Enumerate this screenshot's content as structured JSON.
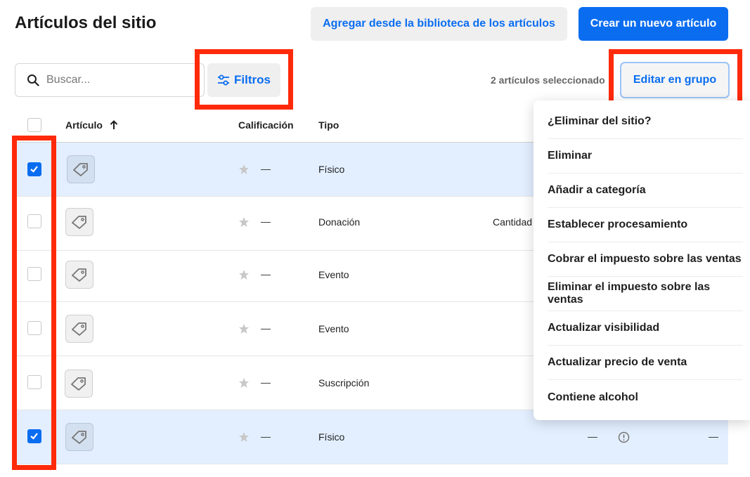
{
  "header": {
    "title": "Artículos del sitio",
    "add_from_library_label": "Agregar desde la biblioteca de los artículos",
    "create_new_label": "Crear un nuevo artículo"
  },
  "toolbar": {
    "search_placeholder": "Buscar...",
    "filters_label": "Filtros",
    "selected_count_text": "2 artículos seleccionado",
    "bulk_edit_label": "Editar en grupo"
  },
  "table": {
    "columns": {
      "item": "Artículo",
      "rating": "Calificación",
      "type": "Tipo"
    },
    "sort_icon": "arrow-up-icon",
    "rows": [
      {
        "selected": true,
        "rating": "—",
        "type": "Físico",
        "extra": ""
      },
      {
        "selected": false,
        "rating": "—",
        "type": "Donación",
        "extra": "Cantidad"
      },
      {
        "selected": false,
        "rating": "—",
        "type": "Evento",
        "extra": ""
      },
      {
        "selected": false,
        "rating": "—",
        "type": "Evento",
        "extra": ""
      },
      {
        "selected": false,
        "rating": "—",
        "type": "Suscripción",
        "extra": ""
      },
      {
        "selected": true,
        "rating": "—",
        "type": "Físico",
        "extra": "",
        "col_a": "—",
        "col_c": "—"
      }
    ]
  },
  "bulk_menu": {
    "items": [
      "¿Eliminar del sitio?",
      "Eliminar",
      "Añadir a categoría",
      "Establecer procesamiento",
      "Cobrar el impuesto sobre las ventas",
      "Eliminar el impuesto sobre las ventas",
      "Actualizar visibilidad",
      "Actualizar precio de venta",
      "Contiene alcohol"
    ]
  },
  "colors": {
    "accent": "#0a6df0",
    "highlight": "#ff2a0a",
    "selected_row": "#e3efff"
  }
}
